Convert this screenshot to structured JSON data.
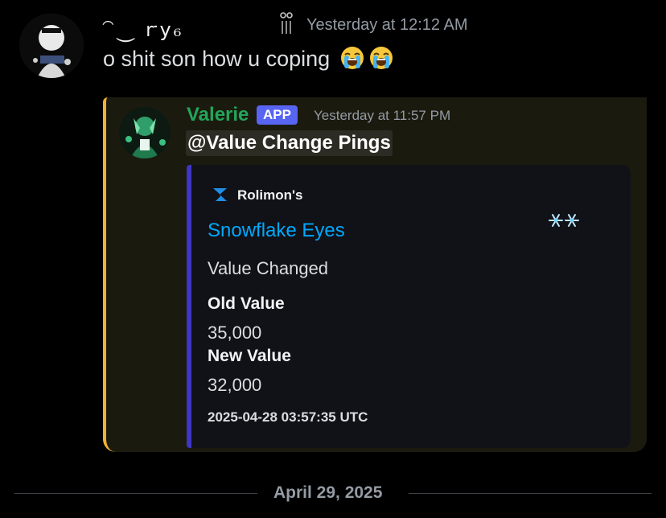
{
  "message": {
    "username": "⁀⏝   ꭈ𝗒₆",
    "timestamp": "Yesterday at 12:12 AM",
    "text": "o shit son how u coping",
    "emoji": "loudly-crying-face"
  },
  "reply": {
    "bot_name": "Valerie",
    "badge": "APP",
    "timestamp": "Yesterday at 11:57 PM",
    "mention": "@Value Change Pings",
    "accent_color": "#f0b232",
    "embed": {
      "author": "Rolimon's",
      "title": "Snowflake Eyes",
      "description": "Value Changed",
      "fields": [
        {
          "name": "Old Value",
          "value": "35,000"
        },
        {
          "name": "New Value",
          "value": "32,000"
        }
      ],
      "footer": "2025-04-28 03:57:35 UTC",
      "color": "#3f36c4"
    }
  },
  "divider": {
    "date": "April 29, 2025"
  }
}
